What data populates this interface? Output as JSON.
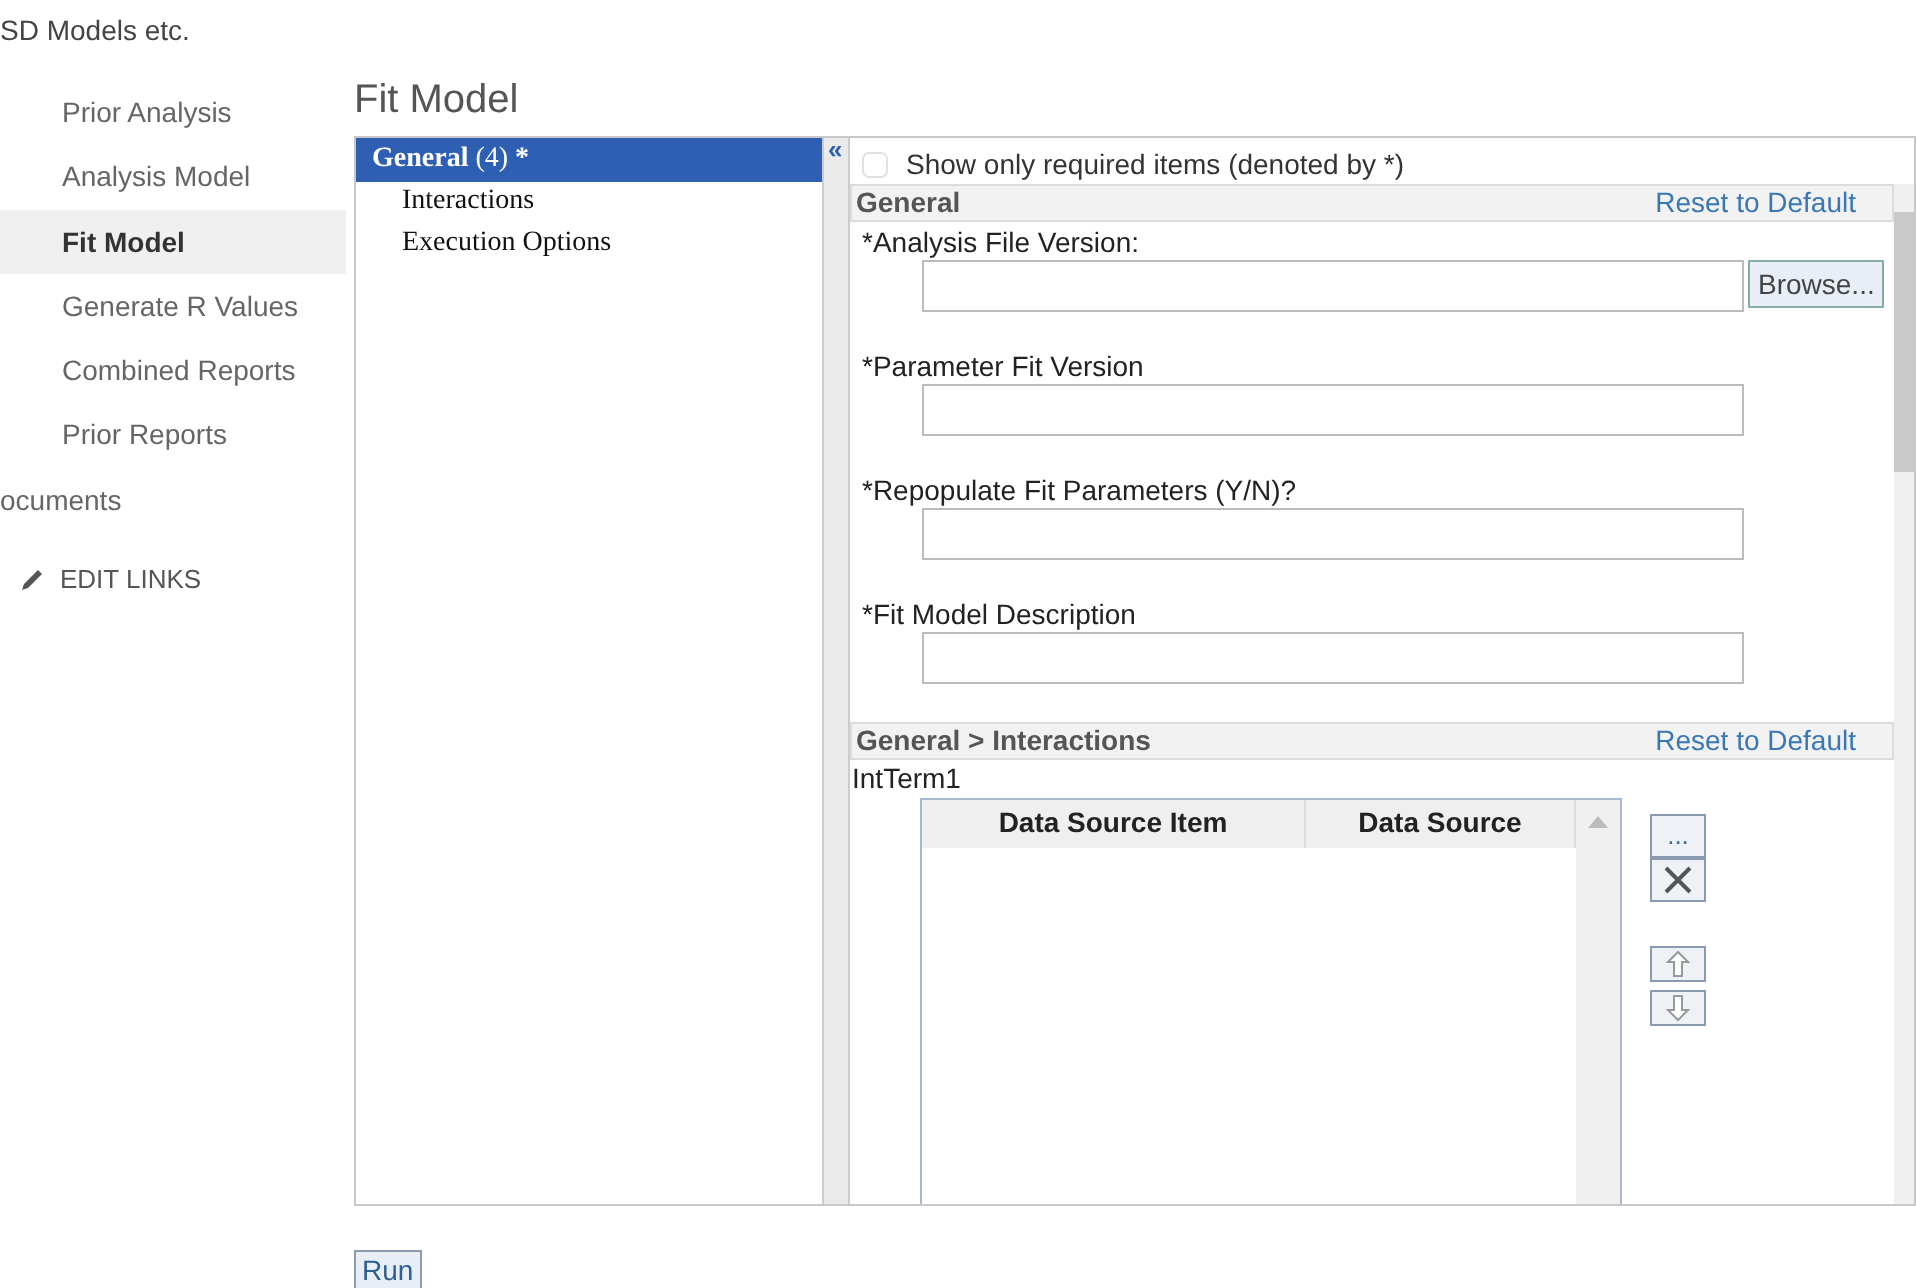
{
  "site_title": "SD Models etc.",
  "nav": [
    {
      "label": "Prior Analysis",
      "kind": "sub",
      "selected": false
    },
    {
      "label": "Analysis Model",
      "kind": "sub",
      "selected": false
    },
    {
      "label": "Fit Model",
      "kind": "sub",
      "selected": true
    },
    {
      "label": "Generate R Values",
      "kind": "sub",
      "selected": false
    },
    {
      "label": "Combined Reports",
      "kind": "sub",
      "selected": false
    },
    {
      "label": "Prior Reports",
      "kind": "sub",
      "selected": false
    },
    {
      "label": "ocuments",
      "kind": "top",
      "selected": false
    }
  ],
  "edit_links": "EDIT LINKS",
  "page_title": "Fit Model",
  "tree": [
    {
      "label": "General",
      "count": "(4)",
      "marker": "*",
      "selected": true,
      "children": [
        {
          "label": "Interactions",
          "selected": false
        },
        {
          "label": "Execution Options",
          "selected": false
        }
      ]
    }
  ],
  "collapse": "«",
  "show_required": {
    "label": "Show only required items (denoted by *)",
    "checked": false
  },
  "sections": [
    {
      "title": "General",
      "reset": "Reset to Default",
      "fields": [
        {
          "label": "*Analysis File Version:",
          "browse": "Browse..."
        },
        {
          "label": "*Parameter Fit Version"
        },
        {
          "label": "*Repopulate Fit Parameters (Y/N)?"
        },
        {
          "label": "*Fit Model Description"
        }
      ]
    },
    {
      "title": "General > Interactions",
      "reset": "Reset to Default",
      "group": "IntTerm1",
      "columns": [
        "Data Source Item",
        "Data Source"
      ],
      "side_buttons": [
        {
          "kind": "more",
          "text": "..."
        },
        {
          "kind": "delete"
        },
        {
          "kind": "up"
        },
        {
          "kind": "down"
        }
      ]
    }
  ],
  "run": "Run"
}
